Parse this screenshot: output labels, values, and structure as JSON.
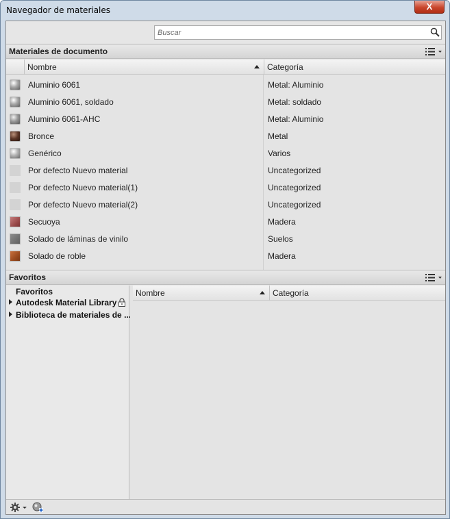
{
  "window": {
    "title": "Navegador de materiales",
    "close_label": "X"
  },
  "search": {
    "placeholder": "Buscar"
  },
  "document_materials": {
    "title": "Materiales de documento",
    "columns": {
      "name": "Nombre",
      "category": "Categoría"
    },
    "rows": [
      {
        "name": "Aluminio 6061",
        "category": "Metal: Aluminio",
        "swatch": "sphere-silver"
      },
      {
        "name": "Aluminio 6061, soldado",
        "category": "Metal: soldado",
        "swatch": "sphere-silver"
      },
      {
        "name": "Aluminio 6061-AHC",
        "category": "Metal: Aluminio",
        "swatch": "sphere-silver"
      },
      {
        "name": "Bronce",
        "category": "Metal",
        "swatch": "sphere-bronze"
      },
      {
        "name": "Genérico",
        "category": "Varios",
        "swatch": "sphere-silver"
      },
      {
        "name": "Por defecto Nuevo material",
        "category": "Uncategorized",
        "swatch": "blank"
      },
      {
        "name": "Por defecto Nuevo material(1)",
        "category": "Uncategorized",
        "swatch": "blank"
      },
      {
        "name": "Por defecto Nuevo material(2)",
        "category": "Uncategorized",
        "swatch": "blank"
      },
      {
        "name": "Secuoya",
        "category": "Madera",
        "swatch": "redwood"
      },
      {
        "name": "Solado de láminas de vinilo",
        "category": "Suelos",
        "swatch": "vinyl"
      },
      {
        "name": "Solado de roble",
        "category": "Madera",
        "swatch": "oak"
      }
    ]
  },
  "favorites": {
    "title": "Favoritos",
    "tree": [
      {
        "label": "Favoritos",
        "expandable": false
      },
      {
        "label": "Autodesk Material Library",
        "expandable": true,
        "locked": true
      },
      {
        "label": "Biblioteca de materiales de ...",
        "expandable": true
      }
    ],
    "columns": {
      "name": "Nombre",
      "category": "Categoría"
    }
  },
  "colors": {
    "accent": "#c9462c",
    "panel": "#e4e4e4",
    "header": "#d9d9d9"
  },
  "icons": [
    "search-icon",
    "view-options-icon",
    "lock-icon",
    "gear-icon",
    "add-library-icon",
    "close-icon"
  ]
}
